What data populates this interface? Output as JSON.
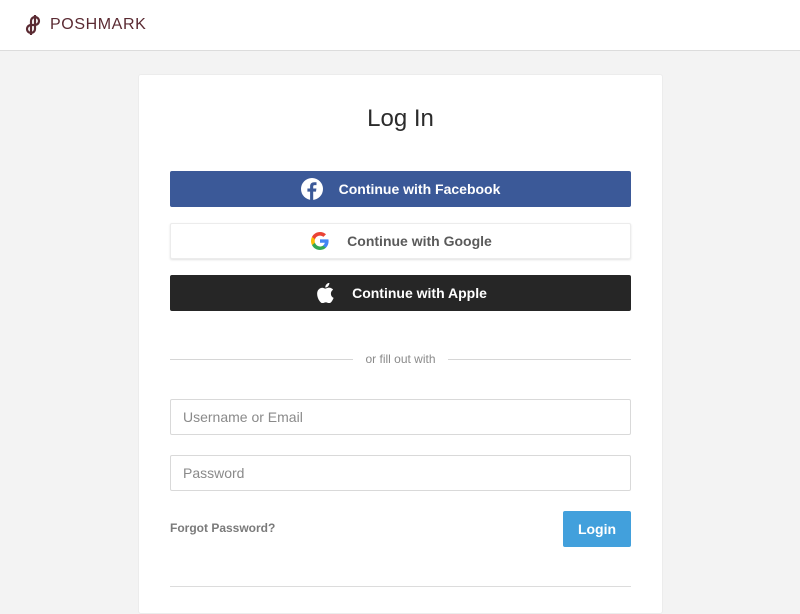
{
  "header": {
    "brand": "POSHMARK",
    "logo_icon": "poshmark-logo-icon",
    "brand_color": "#5a2a32"
  },
  "login": {
    "title": "Log In",
    "facebook_label": "Continue with Facebook",
    "google_label": "Continue with Google",
    "apple_label": "Continue with Apple",
    "divider_text": "or fill out with",
    "username_placeholder": "Username or Email",
    "password_placeholder": "Password",
    "forgot_label": "Forgot Password?",
    "login_label": "Login"
  },
  "colors": {
    "facebook": "#3b5998",
    "apple": "#262626",
    "login_button": "#42a0dc",
    "background": "#f3f3f3"
  }
}
